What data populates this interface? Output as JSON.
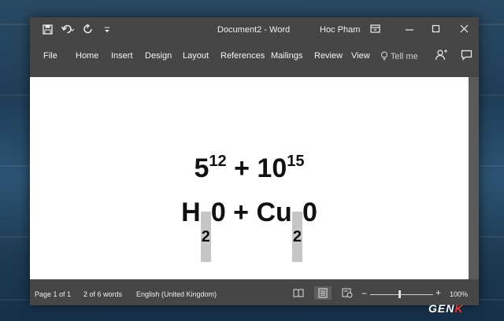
{
  "window": {
    "title": "Document2  -  Word",
    "user": "Hoc Pham",
    "colors": {
      "chrome": "#464646",
      "page": "#ffffff",
      "highlight": "#c6c6c6"
    }
  },
  "quick_access": {
    "icons": [
      "save-icon",
      "undo-icon",
      "redo-icon",
      "customize-icon"
    ]
  },
  "ribbon": {
    "tabs": [
      "File",
      "Home",
      "Insert",
      "Design",
      "Layout",
      "References",
      "Mailings",
      "Review",
      "View"
    ],
    "tell_me": "Tell me"
  },
  "document": {
    "line1": {
      "base1": "5",
      "sup1": "12",
      "plus": "+",
      "base2": "10",
      "sup2": "15"
    },
    "line2": {
      "a": "H",
      "sub1": "2",
      "b": "0 + Cu",
      "sub2": "2",
      "c": "0"
    }
  },
  "status": {
    "page": "Page 1 of 1",
    "words": "2 of 6 words",
    "language": "English (United Kingdom)",
    "zoom": "100%"
  },
  "watermark": {
    "text": "GEN",
    "accent": "K"
  }
}
